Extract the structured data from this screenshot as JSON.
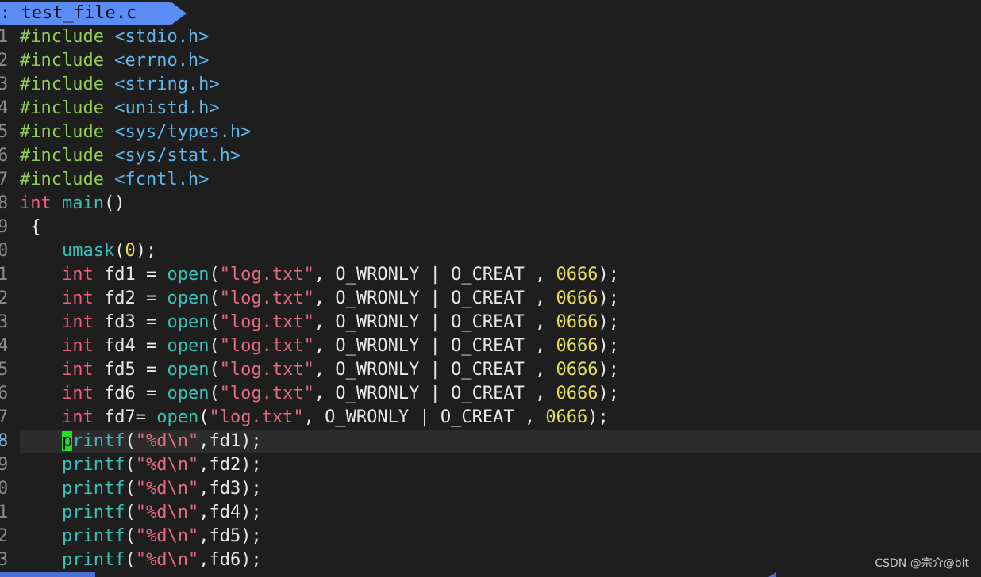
{
  "tab": {
    "prefix": ": ",
    "filename": "test_file.c"
  },
  "watermark": "CSDN @宗介@bit",
  "lines": [
    {
      "ln": "1",
      "tokens": [
        {
          "t": "#include ",
          "c": "pp"
        },
        {
          "t": "<stdio.h>",
          "c": "hdr"
        }
      ]
    },
    {
      "ln": "2",
      "tokens": [
        {
          "t": "#include ",
          "c": "pp"
        },
        {
          "t": "<errno.h>",
          "c": "hdr"
        }
      ]
    },
    {
      "ln": "3",
      "tokens": [
        {
          "t": "#include ",
          "c": "pp"
        },
        {
          "t": "<string.h>",
          "c": "hdr"
        }
      ]
    },
    {
      "ln": "4",
      "tokens": [
        {
          "t": "#include ",
          "c": "pp"
        },
        {
          "t": "<unistd.h>",
          "c": "hdr"
        }
      ]
    },
    {
      "ln": "5",
      "tokens": [
        {
          "t": "#include ",
          "c": "pp"
        },
        {
          "t": "<sys/types.h>",
          "c": "hdr"
        }
      ]
    },
    {
      "ln": "6",
      "tokens": [
        {
          "t": "#include ",
          "c": "pp"
        },
        {
          "t": "<sys/stat.h>",
          "c": "hdr"
        }
      ]
    },
    {
      "ln": "7",
      "tokens": [
        {
          "t": "#include ",
          "c": "pp"
        },
        {
          "t": "<fcntl.h>",
          "c": "hdr"
        }
      ]
    },
    {
      "ln": "8",
      "tokens": [
        {
          "t": "int",
          "c": "kw"
        },
        {
          "t": " ",
          "c": "plain"
        },
        {
          "t": "main",
          "c": "fn"
        },
        {
          "t": "()",
          "c": "plain"
        }
      ]
    },
    {
      "ln": "9",
      "tokens": [
        {
          "t": " {",
          "c": "plain"
        }
      ]
    },
    {
      "ln": "0",
      "tokens": [
        {
          "t": "    ",
          "c": "plain"
        },
        {
          "t": "umask",
          "c": "fn"
        },
        {
          "t": "(",
          "c": "plain"
        },
        {
          "t": "0",
          "c": "num"
        },
        {
          "t": ");",
          "c": "plain"
        }
      ]
    },
    {
      "ln": "1",
      "tokens": [
        {
          "t": "    ",
          "c": "plain"
        },
        {
          "t": "int",
          "c": "kw"
        },
        {
          "t": " fd1 = ",
          "c": "plain"
        },
        {
          "t": "open",
          "c": "fn"
        },
        {
          "t": "(",
          "c": "plain"
        },
        {
          "t": "\"log.txt\"",
          "c": "str"
        },
        {
          "t": ", O_WRONLY | O_CREAT , ",
          "c": "plain"
        },
        {
          "t": "0666",
          "c": "num"
        },
        {
          "t": ");",
          "c": "plain"
        }
      ]
    },
    {
      "ln": "2",
      "tokens": [
        {
          "t": "    ",
          "c": "plain"
        },
        {
          "t": "int",
          "c": "kw"
        },
        {
          "t": " fd2 = ",
          "c": "plain"
        },
        {
          "t": "open",
          "c": "fn"
        },
        {
          "t": "(",
          "c": "plain"
        },
        {
          "t": "\"log.txt\"",
          "c": "str"
        },
        {
          "t": ", O_WRONLY | O_CREAT , ",
          "c": "plain"
        },
        {
          "t": "0666",
          "c": "num"
        },
        {
          "t": ");",
          "c": "plain"
        }
      ]
    },
    {
      "ln": "3",
      "tokens": [
        {
          "t": "    ",
          "c": "plain"
        },
        {
          "t": "int",
          "c": "kw"
        },
        {
          "t": " fd3 = ",
          "c": "plain"
        },
        {
          "t": "open",
          "c": "fn"
        },
        {
          "t": "(",
          "c": "plain"
        },
        {
          "t": "\"log.txt\"",
          "c": "str"
        },
        {
          "t": ", O_WRONLY | O_CREAT , ",
          "c": "plain"
        },
        {
          "t": "0666",
          "c": "num"
        },
        {
          "t": ");",
          "c": "plain"
        }
      ]
    },
    {
      "ln": "4",
      "tokens": [
        {
          "t": "    ",
          "c": "plain"
        },
        {
          "t": "int",
          "c": "kw"
        },
        {
          "t": " fd4 = ",
          "c": "plain"
        },
        {
          "t": "open",
          "c": "fn"
        },
        {
          "t": "(",
          "c": "plain"
        },
        {
          "t": "\"log.txt\"",
          "c": "str"
        },
        {
          "t": ", O_WRONLY | O_CREAT , ",
          "c": "plain"
        },
        {
          "t": "0666",
          "c": "num"
        },
        {
          "t": ");",
          "c": "plain"
        }
      ]
    },
    {
      "ln": "5",
      "tokens": [
        {
          "t": "    ",
          "c": "plain"
        },
        {
          "t": "int",
          "c": "kw"
        },
        {
          "t": " fd5 = ",
          "c": "plain"
        },
        {
          "t": "open",
          "c": "fn"
        },
        {
          "t": "(",
          "c": "plain"
        },
        {
          "t": "\"log.txt\"",
          "c": "str"
        },
        {
          "t": ", O_WRONLY | O_CREAT , ",
          "c": "plain"
        },
        {
          "t": "0666",
          "c": "num"
        },
        {
          "t": ");",
          "c": "plain"
        }
      ]
    },
    {
      "ln": "6",
      "tokens": [
        {
          "t": "    ",
          "c": "plain"
        },
        {
          "t": "int",
          "c": "kw"
        },
        {
          "t": " fd6 = ",
          "c": "plain"
        },
        {
          "t": "open",
          "c": "fn"
        },
        {
          "t": "(",
          "c": "plain"
        },
        {
          "t": "\"log.txt\"",
          "c": "str"
        },
        {
          "t": ", O_WRONLY | O_CREAT , ",
          "c": "plain"
        },
        {
          "t": "0666",
          "c": "num"
        },
        {
          "t": ");",
          "c": "plain"
        }
      ]
    },
    {
      "ln": "7",
      "tokens": [
        {
          "t": "    ",
          "c": "plain"
        },
        {
          "t": "int",
          "c": "kw"
        },
        {
          "t": " fd7= ",
          "c": "plain"
        },
        {
          "t": "open",
          "c": "fn"
        },
        {
          "t": "(",
          "c": "plain"
        },
        {
          "t": "\"log.txt\"",
          "c": "str"
        },
        {
          "t": ", O_WRONLY | O_CREAT , ",
          "c": "plain"
        },
        {
          "t": "0666",
          "c": "num"
        },
        {
          "t": ");",
          "c": "plain"
        }
      ]
    },
    {
      "ln": "8",
      "current": true,
      "tokens": [
        {
          "t": "    ",
          "c": "plain"
        },
        {
          "t": "p",
          "c": "fn cursor"
        },
        {
          "t": "rintf",
          "c": "fn"
        },
        {
          "t": "(",
          "c": "plain"
        },
        {
          "t": "\"%d\\n\"",
          "c": "str"
        },
        {
          "t": ",fd1);",
          "c": "plain"
        }
      ]
    },
    {
      "ln": "9",
      "tokens": [
        {
          "t": "    ",
          "c": "plain"
        },
        {
          "t": "printf",
          "c": "fn"
        },
        {
          "t": "(",
          "c": "plain"
        },
        {
          "t": "\"%d\\n\"",
          "c": "str"
        },
        {
          "t": ",fd2);",
          "c": "plain"
        }
      ]
    },
    {
      "ln": "0",
      "tokens": [
        {
          "t": "    ",
          "c": "plain"
        },
        {
          "t": "printf",
          "c": "fn"
        },
        {
          "t": "(",
          "c": "plain"
        },
        {
          "t": "\"%d\\n\"",
          "c": "str"
        },
        {
          "t": ",fd3);",
          "c": "plain"
        }
      ]
    },
    {
      "ln": "1",
      "tokens": [
        {
          "t": "    ",
          "c": "plain"
        },
        {
          "t": "printf",
          "c": "fn"
        },
        {
          "t": "(",
          "c": "plain"
        },
        {
          "t": "\"%d\\n\"",
          "c": "str"
        },
        {
          "t": ",fd4);",
          "c": "plain"
        }
      ]
    },
    {
      "ln": "2",
      "tokens": [
        {
          "t": "    ",
          "c": "plain"
        },
        {
          "t": "printf",
          "c": "fn"
        },
        {
          "t": "(",
          "c": "plain"
        },
        {
          "t": "\"%d\\n\"",
          "c": "str"
        },
        {
          "t": ",fd5);",
          "c": "plain"
        }
      ]
    },
    {
      "ln": "3",
      "tokens": [
        {
          "t": "    ",
          "c": "plain"
        },
        {
          "t": "printf",
          "c": "fn"
        },
        {
          "t": "(",
          "c": "plain"
        },
        {
          "t": "\"%d\\n\"",
          "c": "str"
        },
        {
          "t": ",fd6);",
          "c": "plain"
        }
      ]
    }
  ]
}
